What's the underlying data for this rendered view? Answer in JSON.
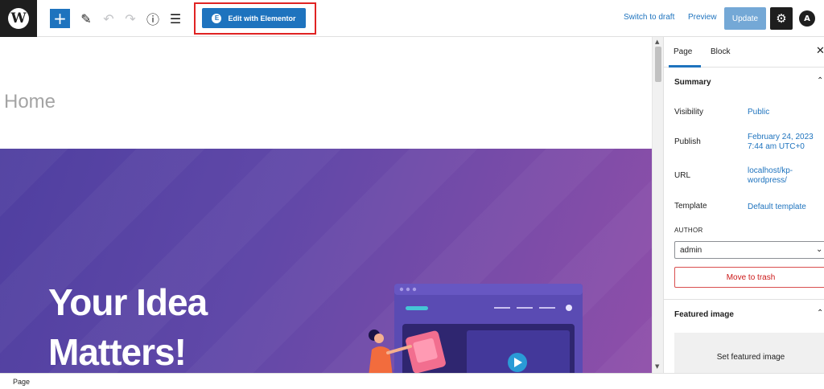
{
  "toolbar": {
    "add_icon": "+",
    "edit_with_elementor_label": "Edit with Elementor",
    "switch_to_draft_label": "Switch to draft",
    "preview_label": "Preview",
    "update_label": "Update",
    "accent_color": "#1e73be"
  },
  "editor": {
    "page_title": "Home",
    "hero_heading_line1": "Your Idea",
    "hero_heading_line2": "Matters!"
  },
  "sidebar": {
    "tabs": [
      {
        "label": "Page",
        "active": true
      },
      {
        "label": "Block",
        "active": false
      }
    ],
    "summary": {
      "title": "Summary",
      "rows": [
        {
          "label": "Visibility",
          "value": "Public"
        },
        {
          "label": "Publish",
          "value": "February 24, 2023\n7:44 am UTC+0"
        },
        {
          "label": "URL",
          "value": "localhost/kp-\nwordpress/"
        },
        {
          "label": "Template",
          "value": "Default template"
        }
      ],
      "author_label": "AUTHOR",
      "author_value": "admin",
      "trash_label": "Move to trash"
    },
    "featured_image": {
      "title": "Featured image",
      "set_label": "Set featured image"
    }
  },
  "footer": {
    "breadcrumb": "Page"
  }
}
